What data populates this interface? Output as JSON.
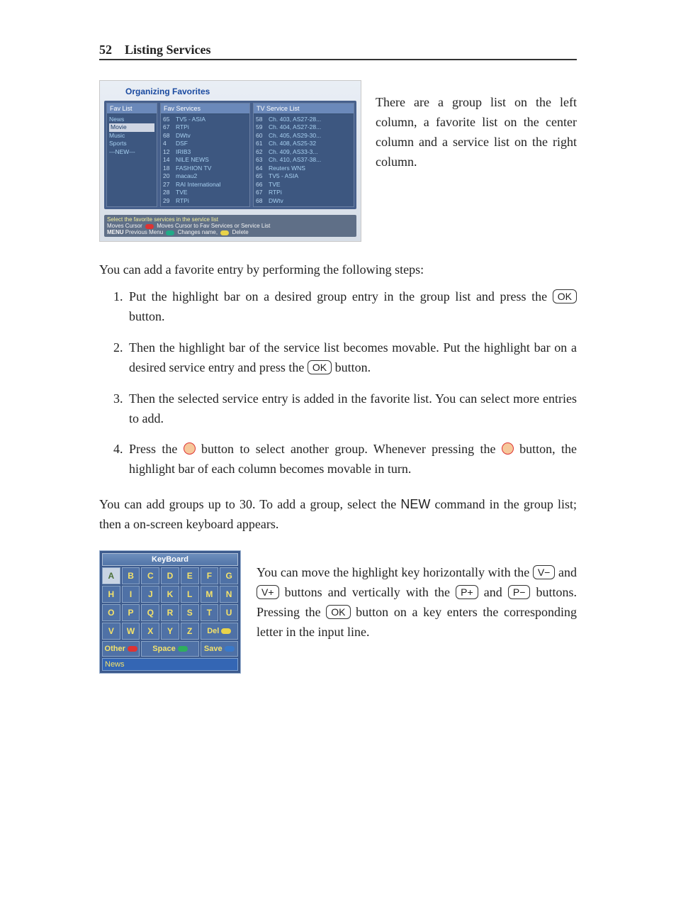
{
  "page": {
    "number": "52",
    "section": "Listing Services"
  },
  "screenshot1": {
    "title": "Organizing Favorites",
    "fav_list_header": "Fav List",
    "fav_services_header": "Fav Services",
    "tv_service_list_header": "TV Service List",
    "fav_list": [
      "News",
      "Movie",
      "Music",
      "Sports",
      "---NEW---"
    ],
    "fav_services": [
      {
        "n": "65",
        "name": "TV5 - ASIA"
      },
      {
        "n": "67",
        "name": "RTPi"
      },
      {
        "n": "68",
        "name": "DWtv"
      },
      {
        "n": "4",
        "name": "DSF"
      },
      {
        "n": "12",
        "name": "IRIB3"
      },
      {
        "n": "14",
        "name": "NILE NEWS"
      },
      {
        "n": "18",
        "name": "FASHION TV"
      },
      {
        "n": "20",
        "name": "macau2"
      },
      {
        "n": "27",
        "name": "RAI International"
      },
      {
        "n": "28",
        "name": "TVE"
      },
      {
        "n": "29",
        "name": "RTPi"
      }
    ],
    "tv_services": [
      {
        "n": "58",
        "name": "Ch. 403, AS27-28..."
      },
      {
        "n": "59",
        "name": "Ch. 404, AS27-28..."
      },
      {
        "n": "60",
        "name": "Ch. 405, AS29-30..."
      },
      {
        "n": "61",
        "name": "Ch. 408, AS25-32"
      },
      {
        "n": "62",
        "name": "Ch. 409, AS33-3..."
      },
      {
        "n": "63",
        "name": "Ch. 410, AS37-38..."
      },
      {
        "n": "64",
        "name": "Reuters WNS"
      },
      {
        "n": "65",
        "name": "TV5 - ASIA"
      },
      {
        "n": "66",
        "name": "TVE"
      },
      {
        "n": "67",
        "name": "RTPi"
      },
      {
        "n": "68",
        "name": "DWtv"
      }
    ],
    "footer": {
      "line1": "Select the favorite services in the service list",
      "moves_cursor": "Moves Cursor",
      "moves_to": "Moves Cursor to Fav Services or Service List",
      "prev_menu": "Previous Menu",
      "changes_name": "Changes name,",
      "delete": "Delete"
    }
  },
  "text": {
    "intro1": "There are a group list on the left column, a favorite list on the center column and a service list on the right column.",
    "intro2": "You can add a favorite entry by performing the following steps:",
    "step1a": "Put the highlight bar on a desired group entry in the group list and press the ",
    "ok": "OK",
    "step1b": " button.",
    "step2a": "Then the highlight bar of the service list becomes movable. Put the highlight bar on a desired service entry and press the ",
    "step2b": " button.",
    "step3": "Then the selected service entry is added in the favorite list. You can select more entries to add.",
    "step4a": "Press the ",
    "step4b": " button to select another group. Whenever pressing the ",
    "step4c": " button, the highlight bar of each column becomes movable in turn.",
    "para2a": "You can add groups up to 30. To add a group, select the ",
    "new": "NEW",
    "para2b": " command in the group list; then a on-screen keyboard appears.",
    "kb_para_a": "You can move the highlight key horizontally with the ",
    "vminus": "V−",
    "and": " and ",
    "vplus": "V+",
    "kb_para_b": " buttons and vertically with the ",
    "pplus": "P+",
    "pminus": "P−",
    "kb_para_c": " buttons. Pressing the ",
    "kb_para_d": " button on a key enters the corresponding letter in the input line."
  },
  "keyboard": {
    "title": "KeyBoard",
    "rows": [
      [
        "A",
        "B",
        "C",
        "D",
        "E",
        "F",
        "G"
      ],
      [
        "H",
        "I",
        "J",
        "K",
        "L",
        "M",
        "N"
      ],
      [
        "O",
        "P",
        "Q",
        "R",
        "S",
        "T",
        "U"
      ],
      [
        "V",
        "W",
        "X",
        "Y",
        "Z"
      ]
    ],
    "del": "Del",
    "other": "Other",
    "space": "Space",
    "save": "Save",
    "input": "News"
  }
}
